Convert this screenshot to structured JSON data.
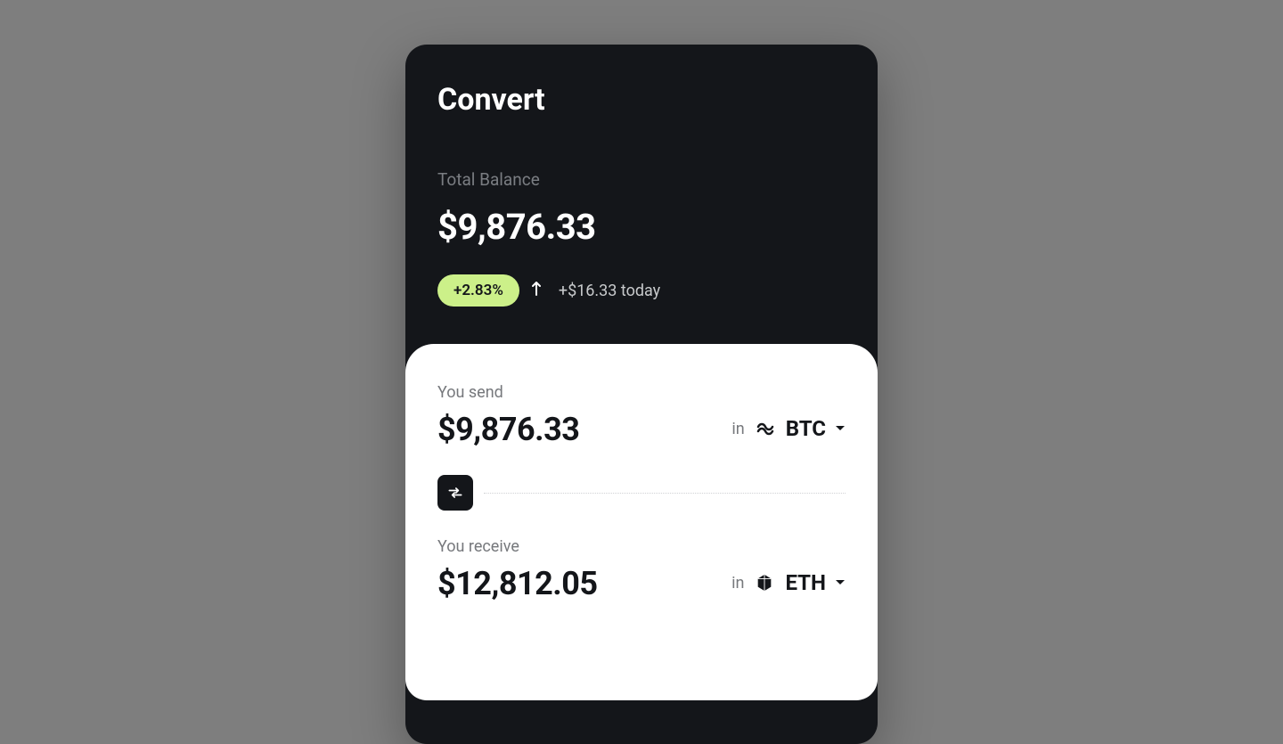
{
  "title": "Convert",
  "balance": {
    "label": "Total Balance",
    "amount": "$9,876.33",
    "change_percent": "+2.83%",
    "change_today": "+$16.33 today"
  },
  "send": {
    "label": "You send",
    "amount": "$9,876.33",
    "in_label": "in",
    "currency": "BTC",
    "currency_icon": "btc-icon"
  },
  "receive": {
    "label": "You receive",
    "amount": "$12,812.05",
    "in_label": "in",
    "currency": "ETH",
    "currency_icon": "eth-icon"
  }
}
